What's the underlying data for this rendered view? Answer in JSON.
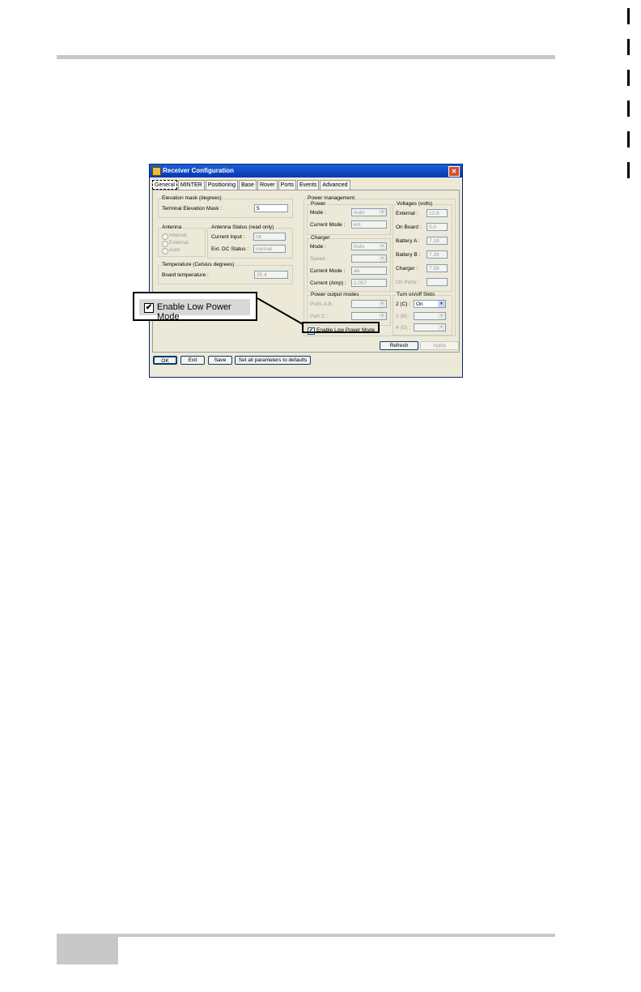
{
  "window": {
    "title": "Receiver Configuration",
    "close": "✕",
    "tabs": [
      "General",
      "MINTER",
      "Positioning",
      "Base",
      "Rover",
      "Ports",
      "Events",
      "Advanced"
    ]
  },
  "elevation": {
    "label": "Elevation mask (degrees)",
    "field_label": "Terminal Elevation Mask :",
    "value": "5"
  },
  "antenna": {
    "label": "Antenna",
    "options": [
      "Internal",
      "External",
      "Auto"
    ]
  },
  "antenna_status": {
    "label": "Antenna Status (read only)",
    "current_input_label": "Current Input :",
    "current_input_value": "int",
    "ext_dc_label": "Ext. DC Status :",
    "ext_dc_value": "normal"
  },
  "temperature": {
    "label": "Temperature (Celsius degrees)",
    "board_label": "Board temperature :",
    "board_value": "35.4"
  },
  "power_management": {
    "label": "Power management",
    "power": {
      "label": "Power",
      "mode_label": "Mode :",
      "mode_value": "Auto",
      "current_mode_label": "Current Mode :",
      "current_mode_value": "ext"
    },
    "charger": {
      "label": "Charger",
      "mode_label": "Mode :",
      "mode_value": "Auto",
      "speed_label": "Speed :",
      "current_mode_label": "Current Mode :",
      "current_mode_value": "ab",
      "current_amp_label": "Current (Amp) :",
      "current_amp_value": "2.057"
    },
    "power_output": {
      "label": "Power output modes",
      "ports_ab_label": "Ports A,B :",
      "port_c_label": "Port C :"
    },
    "enable_low_power": "Enable Low Power Mode"
  },
  "voltages": {
    "label": "Voltages (volts)",
    "external_label": "External :",
    "external_value": "12.8",
    "onboard_label": "On Board :",
    "onboard_value": "5.0",
    "battery_a_label": "Battery A :",
    "battery_a_value": "7.18",
    "battery_b_label": "Battery B :",
    "battery_b_value": "7.16",
    "charger_label": "Charger :",
    "charger_value": "7.58",
    "on_ports_label": "On Ports :"
  },
  "slots": {
    "label": "Turn on/off Slots",
    "slot2_label": "2 (C) :",
    "slot2_value": "On",
    "slot3_label": "3 (B) :",
    "slot4_label": "4 (D) :"
  },
  "buttons": {
    "refresh": "Refresh",
    "apply": "Apply",
    "ok": "OK",
    "exit": "Exit",
    "save": "Save",
    "defaults": "Set all parameters to defaults"
  },
  "callout": {
    "label": "Enable Low Power Mode",
    "check": "✔"
  }
}
